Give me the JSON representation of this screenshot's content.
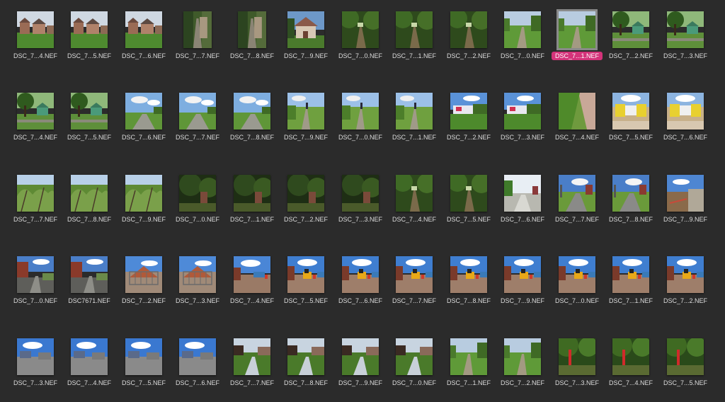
{
  "colors": {
    "background": "#2b2b2b",
    "label": "#dcdcdc",
    "selected_label_bg": "#d4337a",
    "selected_border": "#8a8a8a"
  },
  "files": [
    {
      "name": "DSC_7...4.NEF",
      "scene": "houses",
      "selected": false
    },
    {
      "name": "DSC_7...5.NEF",
      "scene": "houses",
      "selected": false
    },
    {
      "name": "DSC_7...6.NEF",
      "scene": "houses",
      "selected": false
    },
    {
      "name": "DSC_7...7.NEF",
      "scene": "alley",
      "selected": false
    },
    {
      "name": "DSC_7...8.NEF",
      "scene": "alley",
      "selected": false
    },
    {
      "name": "DSC_7...9.NEF",
      "scene": "house",
      "selected": false
    },
    {
      "name": "DSC_7...0.NEF",
      "scene": "forestpath",
      "selected": false
    },
    {
      "name": "DSC_7...1.NEF",
      "scene": "forestpath",
      "selected": false
    },
    {
      "name": "DSC_7...2.NEF",
      "scene": "forestpath",
      "selected": false
    },
    {
      "name": "DSC_7...0.NEF",
      "scene": "greenpath",
      "selected": false
    },
    {
      "name": "DSC_7...1.NEF",
      "scene": "greenpath",
      "selected": true
    },
    {
      "name": "DSC_7...2.NEF",
      "scene": "park",
      "selected": false
    },
    {
      "name": "DSC_7...3.NEF",
      "scene": "park",
      "selected": false
    },
    {
      "name": "DSC_7...4.NEF",
      "scene": "park",
      "selected": false
    },
    {
      "name": "DSC_7...5.NEF",
      "scene": "park",
      "selected": false
    },
    {
      "name": "DSC_7...6.NEF",
      "scene": "field",
      "selected": false
    },
    {
      "name": "DSC_7...7.NEF",
      "scene": "field",
      "selected": false
    },
    {
      "name": "DSC_7...8.NEF",
      "scene": "field",
      "selected": false
    },
    {
      "name": "DSC_7...9.NEF",
      "scene": "trackperson",
      "selected": false
    },
    {
      "name": "DSC_7...0.NEF",
      "scene": "trackperson",
      "selected": false
    },
    {
      "name": "DSC_7...1.NEF",
      "scene": "trackperson",
      "selected": false
    },
    {
      "name": "DSC_7...2.NEF",
      "scene": "hoarding",
      "selected": false
    },
    {
      "name": "DSC_7...3.NEF",
      "scene": "hoarding",
      "selected": false
    },
    {
      "name": "DSC_7...4.NEF",
      "scene": "verge",
      "selected": false
    },
    {
      "name": "DSC_7...5.NEF",
      "scene": "gate",
      "selected": false
    },
    {
      "name": "DSC_7...6.NEF",
      "scene": "gate",
      "selected": false
    },
    {
      "name": "DSC_7...7.NEF",
      "scene": "bushes",
      "selected": false
    },
    {
      "name": "DSC_7...8.NEF",
      "scene": "bushes",
      "selected": false
    },
    {
      "name": "DSC_7...9.NEF",
      "scene": "bushes",
      "selected": false
    },
    {
      "name": "DSC_7...0.NEF",
      "scene": "darkwood",
      "selected": false
    },
    {
      "name": "DSC_7...1.NEF",
      "scene": "darkwood",
      "selected": false
    },
    {
      "name": "DSC_7...2.NEF",
      "scene": "darkwood",
      "selected": false
    },
    {
      "name": "DSC_7...3.NEF",
      "scene": "darkwood",
      "selected": false
    },
    {
      "name": "DSC_7...4.NEF",
      "scene": "forestpath",
      "selected": false
    },
    {
      "name": "DSC_7...5.NEF",
      "scene": "forestpath",
      "selected": false
    },
    {
      "name": "DSC_7...6.NEF",
      "scene": "brightroad",
      "selected": false
    },
    {
      "name": "DSC_7...7.NEF",
      "scene": "road",
      "selected": false
    },
    {
      "name": "DSC_7...8.NEF",
      "scene": "road",
      "selected": false
    },
    {
      "name": "DSC_7...9.NEF",
      "scene": "wall",
      "selected": false
    },
    {
      "name": "DSC_7...0.NEF",
      "scene": "brickpath",
      "selected": false
    },
    {
      "name": "DSC7671.NEF",
      "scene": "brickpath",
      "selected": false
    },
    {
      "name": "DSC_7...2.NEF",
      "scene": "fence",
      "selected": false
    },
    {
      "name": "DSC_7...3.NEF",
      "scene": "fence",
      "selected": false
    },
    {
      "name": "DSC_7...4.NEF",
      "scene": "site",
      "selected": false
    },
    {
      "name": "DSC_7...5.NEF",
      "scene": "digger",
      "selected": false
    },
    {
      "name": "DSC_7...6.NEF",
      "scene": "digger",
      "selected": false
    },
    {
      "name": "DSC_7...7.NEF",
      "scene": "digger",
      "selected": false
    },
    {
      "name": "DSC_7...8.NEF",
      "scene": "digger",
      "selected": false
    },
    {
      "name": "DSC_7...9.NEF",
      "scene": "digger",
      "selected": false
    },
    {
      "name": "DSC_7...0.NEF",
      "scene": "digger",
      "selected": false
    },
    {
      "name": "DSC_7...1.NEF",
      "scene": "digger",
      "selected": false
    },
    {
      "name": "DSC_7...2.NEF",
      "scene": "digger",
      "selected": false
    },
    {
      "name": "DSC_7...3.NEF",
      "scene": "blue",
      "selected": false
    },
    {
      "name": "DSC_7...4.NEF",
      "scene": "blue",
      "selected": false
    },
    {
      "name": "DSC_7...5.NEF",
      "scene": "blue",
      "selected": false
    },
    {
      "name": "DSC_7...6.NEF",
      "scene": "blue",
      "selected": false
    },
    {
      "name": "DSC_7...7.NEF",
      "scene": "stream",
      "selected": false
    },
    {
      "name": "DSC_7...8.NEF",
      "scene": "stream",
      "selected": false
    },
    {
      "name": "DSC_7...9.NEF",
      "scene": "stream",
      "selected": false
    },
    {
      "name": "DSC_7...0.NEF",
      "scene": "stream",
      "selected": false
    },
    {
      "name": "DSC_7...1.NEF",
      "scene": "greenpath",
      "selected": false
    },
    {
      "name": "DSC_7...2.NEF",
      "scene": "greenpath",
      "selected": false
    },
    {
      "name": "DSC_7...3.NEF",
      "scene": "redpost",
      "selected": false
    },
    {
      "name": "DSC_7...4.NEF",
      "scene": "redpost",
      "selected": false
    },
    {
      "name": "DSC_7...5.NEF",
      "scene": "redpost",
      "selected": false
    }
  ]
}
